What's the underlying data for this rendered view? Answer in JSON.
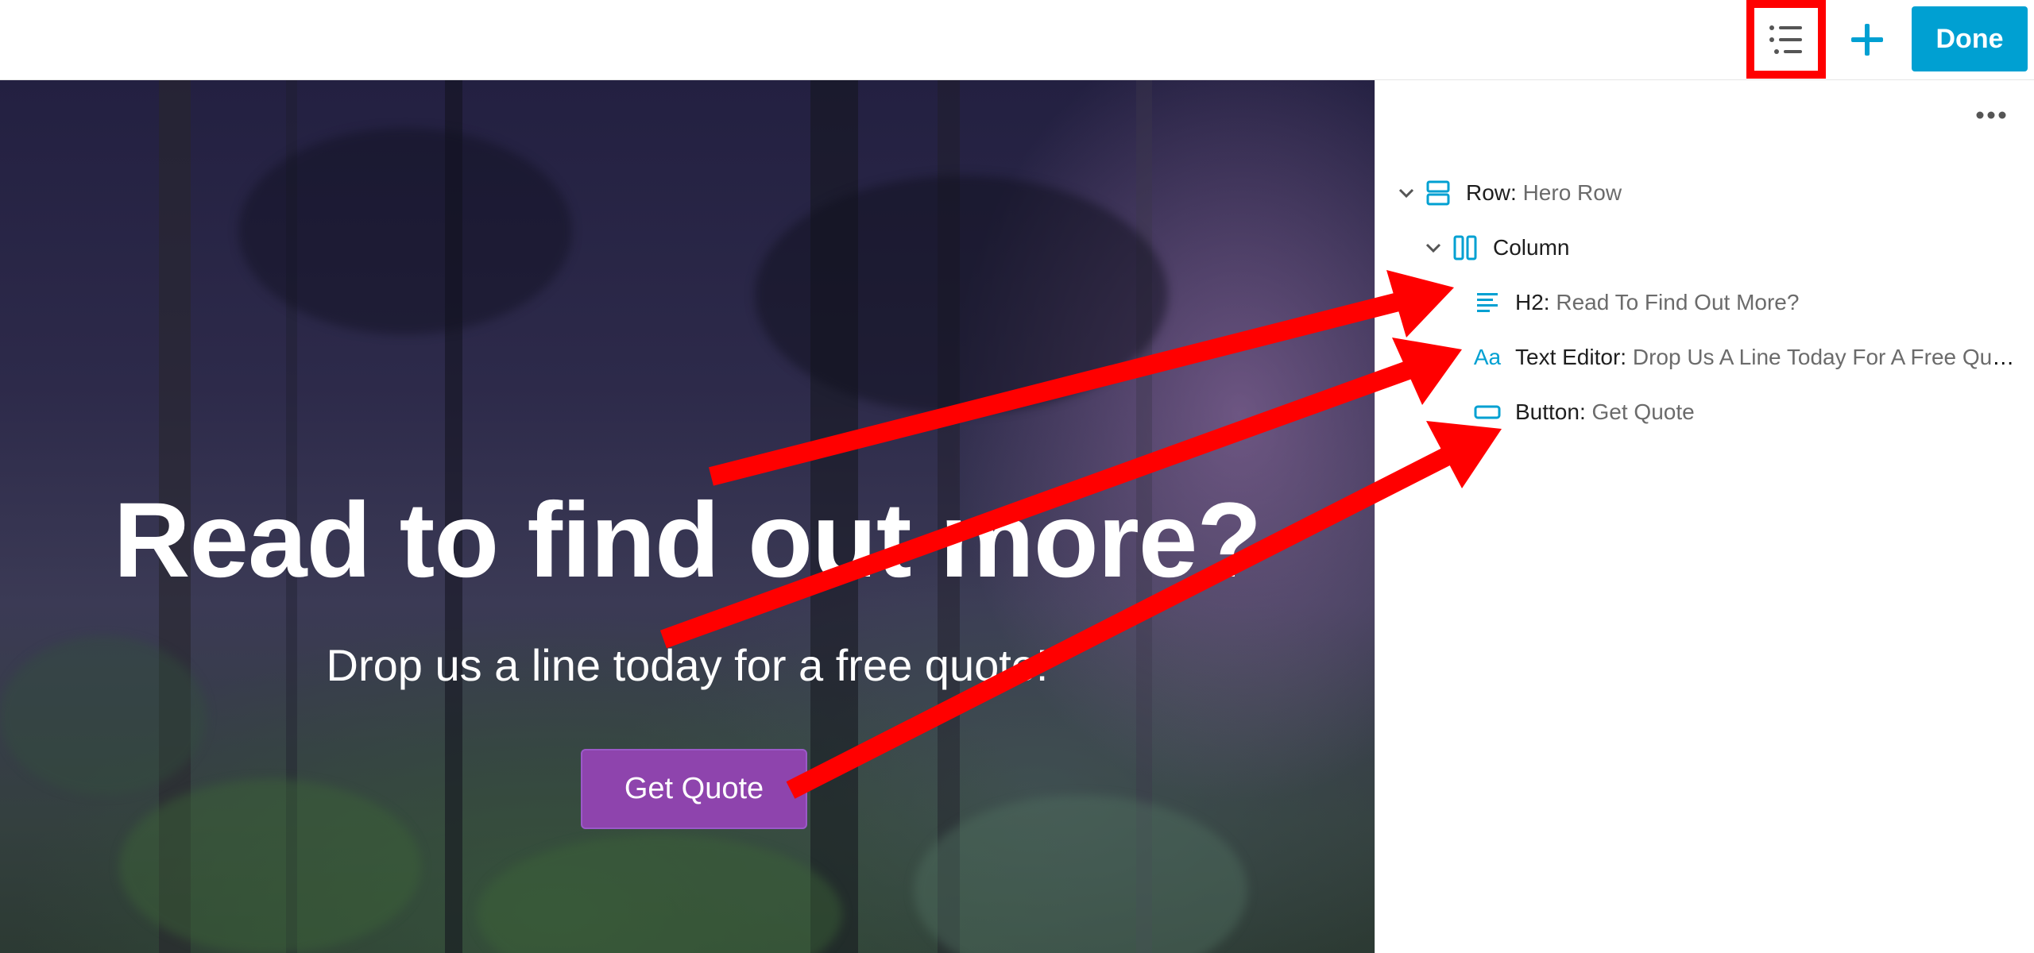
{
  "toolbar": {
    "outline_icon": "list-outline-icon",
    "add_icon": "plus-icon",
    "done_label": "Done"
  },
  "hero": {
    "title": "Read to find out more?",
    "text": "Drop us a line today for a free quote!",
    "button_label": "Get Quote",
    "button_color": "#8e44ad"
  },
  "sidebar": {
    "more_icon": "more-horizontal-icon",
    "items": [
      {
        "type": "Row",
        "label": "Hero Row",
        "icon": "row-icon",
        "expanded": true
      },
      {
        "type": "Column",
        "label": "",
        "icon": "column-icon",
        "expanded": true
      },
      {
        "type": "H2",
        "label": "Read To Find Out More?",
        "icon": "heading-icon"
      },
      {
        "type": "Text Editor",
        "label": "Drop Us A Line Today For A Free Quote!",
        "icon": "text-editor-icon"
      },
      {
        "type": "Button",
        "label": "Get Quote",
        "icon": "button-icon"
      }
    ]
  },
  "colors": {
    "accent": "#00a0d2",
    "annotation": "#ff0000"
  }
}
